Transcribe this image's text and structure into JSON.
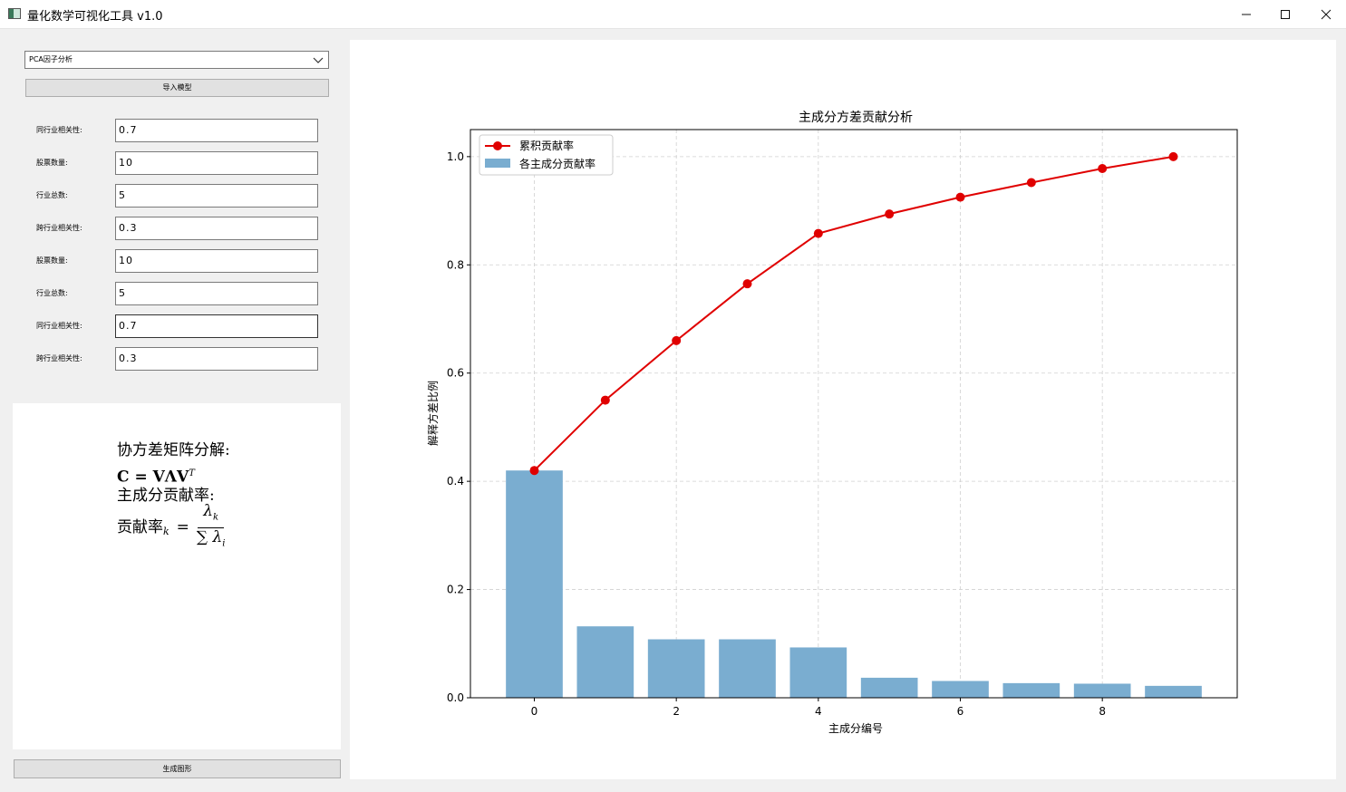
{
  "window": {
    "title": "量化数学可视化工具 v1.0",
    "min_glyph": "—",
    "max_glyph": "☐",
    "close_glyph": "✕"
  },
  "controls": {
    "analysis_select": "PCA因子分析",
    "import_button": "导入模型",
    "fields": [
      {
        "label": "同行业相关性:",
        "value": "0.7"
      },
      {
        "label": "股票数量:",
        "value": "10"
      },
      {
        "label": "行业总数:",
        "value": "5"
      },
      {
        "label": "跨行业相关性:",
        "value": "0.3"
      },
      {
        "label": "股票数量:",
        "value": "10"
      },
      {
        "label": "行业总数:",
        "value": "5"
      },
      {
        "label": "同行业相关性:",
        "value": "0.7"
      },
      {
        "label": "跨行业相关性:",
        "value": "0.3"
      }
    ],
    "generate_button": "生成图形"
  },
  "formula": {
    "line1": "协方差矩阵分解:",
    "line2": "C = VΛV",
    "line2_sup": "T",
    "line3": "主成分贡献率:",
    "line4_lhs": "贡献率",
    "line4_sub": "k",
    "numerator": "λ",
    "numerator_sub": "k",
    "denominator": "∑ λ",
    "denominator_sub": "i"
  },
  "chart_data": {
    "type": "bar",
    "title": "主成分方差贡献分析",
    "xlabel": "主成分编号",
    "ylabel": "解释方差比例",
    "x": [
      0,
      1,
      2,
      3,
      4,
      5,
      6,
      7,
      8,
      9
    ],
    "xticks": [
      "0",
      "2",
      "4",
      "6",
      "8"
    ],
    "yticks": [
      "0.0",
      "0.2",
      "0.4",
      "0.6",
      "0.8",
      "1.0"
    ],
    "ylim": [
      0,
      1.05
    ],
    "xlim": [
      -0.9,
      9.9
    ],
    "grid": true,
    "legend_position": "top-left",
    "series": [
      {
        "name": "累积贡献率",
        "kind": "line",
        "color": "#e00000",
        "values": [
          0.42,
          0.55,
          0.66,
          0.765,
          0.858,
          0.894,
          0.925,
          0.952,
          0.978,
          1.0
        ]
      },
      {
        "name": "各主成分贡献率",
        "kind": "bar",
        "color": "#7aadd0",
        "values": [
          0.42,
          0.132,
          0.108,
          0.108,
          0.093,
          0.037,
          0.031,
          0.027,
          0.026,
          0.022
        ]
      }
    ]
  }
}
